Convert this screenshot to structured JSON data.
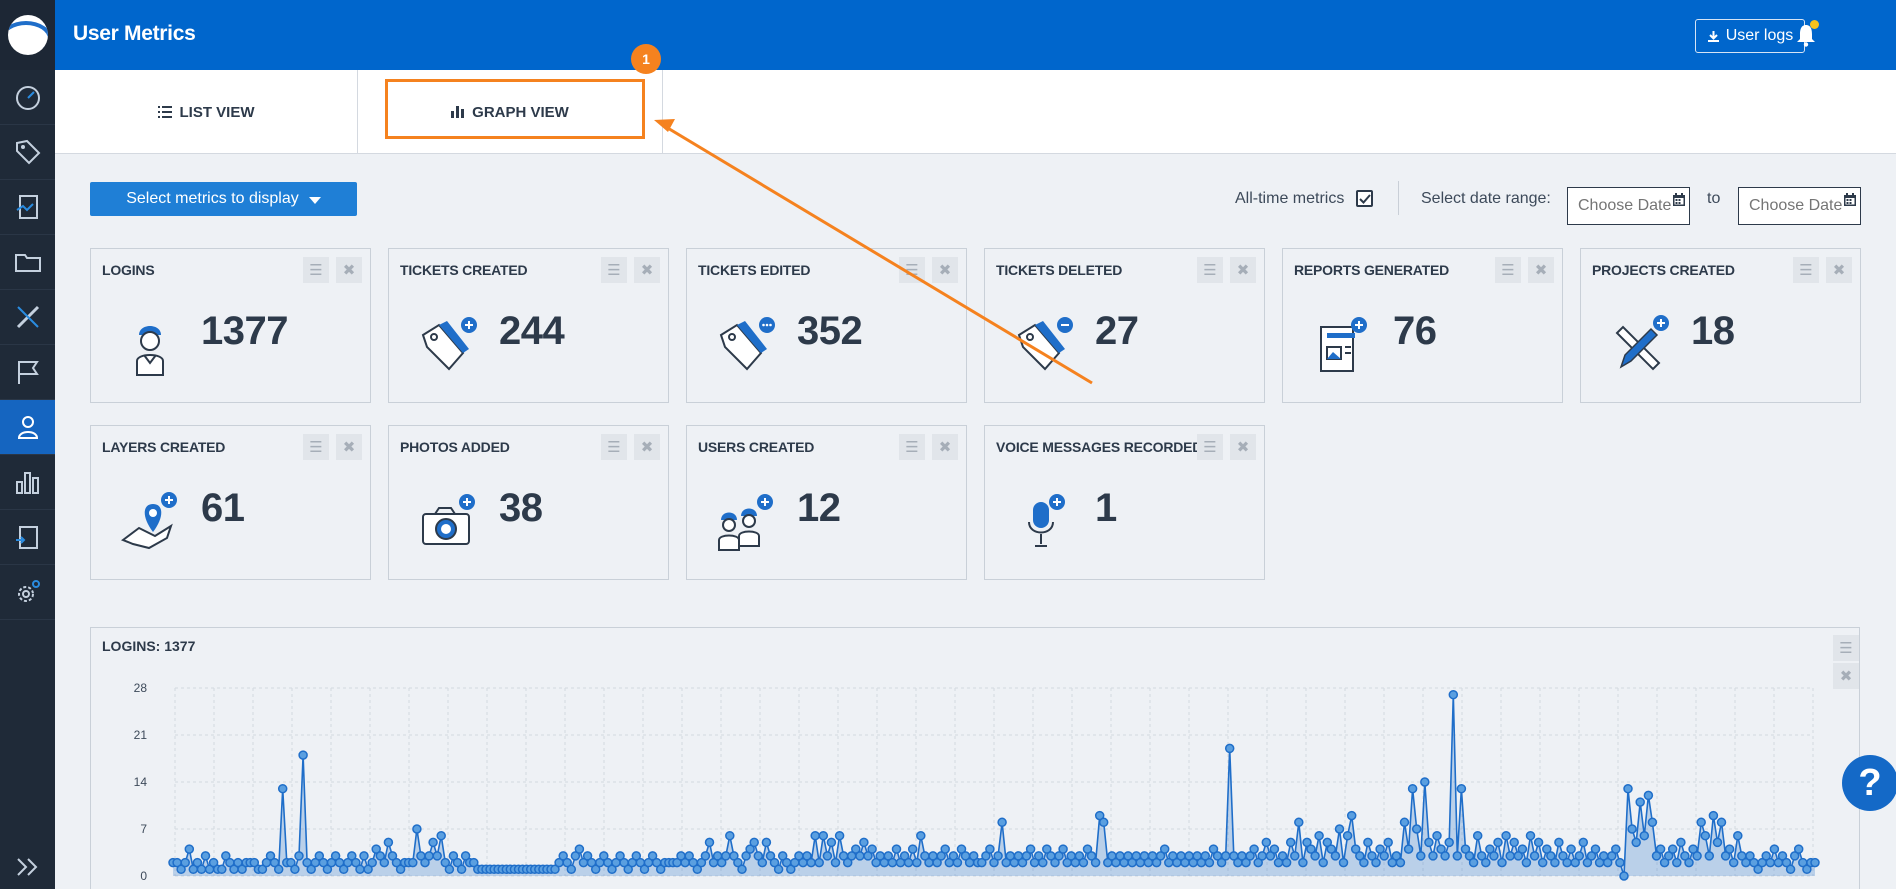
{
  "header": {
    "title": "User Metrics",
    "user_logs_label": "User logs"
  },
  "tabs": [
    {
      "label": "LIST VIEW",
      "icon": "list-icon"
    },
    {
      "label": "GRAPH VIEW",
      "icon": "bar-chart-icon"
    }
  ],
  "annotation": {
    "step": "1",
    "color": "#f5821f"
  },
  "toolbar": {
    "select_label": "Select metrics to display",
    "all_time_label": "All-time metrics",
    "all_time_checked": true,
    "date_range_label": "Select date range:",
    "date_from_placeholder": "Choose Date",
    "to_label": "to",
    "date_to_placeholder": "Choose Date"
  },
  "metrics": [
    {
      "title": "LOGINS",
      "value": "1377",
      "icon": "worker-helmet-icon"
    },
    {
      "title": "TICKETS CREATED",
      "value": "244",
      "icon": "tag-plus-icon"
    },
    {
      "title": "TICKETS EDITED",
      "value": "352",
      "icon": "tag-edit-icon"
    },
    {
      "title": "TICKETS DELETED",
      "value": "27",
      "icon": "tag-minus-icon"
    },
    {
      "title": "REPORTS GENERATED",
      "value": "76",
      "icon": "report-plus-icon"
    },
    {
      "title": "PROJECTS CREATED",
      "value": "18",
      "icon": "ruler-pencil-plus-icon"
    },
    {
      "title": "LAYERS CREATED",
      "value": "61",
      "icon": "map-pin-plus-icon"
    },
    {
      "title": "PHOTOS ADDED",
      "value": "38",
      "icon": "camera-plus-icon"
    },
    {
      "title": "USERS CREATED",
      "value": "12",
      "icon": "users-plus-icon"
    },
    {
      "title": "VOICE MESSAGES RECORDED",
      "value": "1",
      "icon": "microphone-plus-icon"
    }
  ],
  "chart": {
    "title": "LOGINS: 1377",
    "color": "#1f6ec9"
  },
  "chart_data": {
    "type": "line",
    "title": "LOGINS: 1377",
    "ylim": [
      0,
      28
    ],
    "yticks": [
      0,
      7,
      14,
      21,
      28
    ],
    "grid": true,
    "values": [
      2,
      2,
      1,
      2,
      4,
      1,
      2,
      1,
      3,
      1,
      2,
      1,
      1,
      3,
      2,
      1,
      2,
      1,
      2,
      2,
      2,
      1,
      1,
      2,
      3,
      2,
      1,
      13,
      2,
      2,
      1,
      3,
      18,
      2,
      1,
      2,
      3,
      2,
      1,
      2,
      3,
      2,
      1,
      2,
      3,
      2,
      1,
      3,
      1,
      2,
      4,
      3,
      2,
      5,
      3,
      2,
      1,
      2,
      2,
      2,
      7,
      3,
      2,
      3,
      5,
      3,
      6,
      2,
      1,
      3,
      2,
      1,
      3,
      2,
      2,
      1,
      1,
      1,
      1,
      1,
      1,
      1,
      1,
      1,
      1,
      1,
      1,
      1,
      1,
      1,
      1,
      1,
      1,
      1,
      1,
      2,
      3,
      2,
      1,
      3,
      4,
      2,
      3,
      2,
      1,
      2,
      3,
      2,
      1,
      2,
      3,
      2,
      1,
      2,
      3,
      2,
      1,
      2,
      3,
      2,
      1,
      2,
      2,
      2,
      2,
      3,
      2,
      3,
      2,
      1,
      2,
      3,
      5,
      2,
      3,
      2,
      3,
      6,
      3,
      2,
      1,
      3,
      4,
      5,
      3,
      2,
      5,
      3,
      2,
      1,
      3,
      2,
      1,
      2,
      3,
      2,
      3,
      2,
      6,
      2,
      6,
      3,
      5,
      2,
      6,
      3,
      2,
      3,
      4,
      3,
      5,
      3,
      4,
      2,
      3,
      2,
      3,
      2,
      4,
      2,
      3,
      2,
      4,
      2,
      6,
      3,
      2,
      3,
      2,
      3,
      4,
      2,
      3,
      2,
      4,
      3,
      2,
      3,
      2,
      2,
      3,
      4,
      2,
      3,
      8,
      2,
      3,
      2,
      3,
      2,
      3,
      4,
      2,
      3,
      2,
      4,
      3,
      2,
      3,
      4,
      2,
      3,
      2,
      3,
      2,
      4,
      3,
      2,
      9,
      8,
      2,
      3,
      2,
      3,
      2,
      3,
      2,
      3,
      2,
      3,
      2,
      3,
      2,
      3,
      4,
      2,
      3,
      2,
      3,
      2,
      3,
      2,
      3,
      2,
      3,
      2,
      4,
      3,
      2,
      3,
      19,
      3,
      2,
      3,
      2,
      3,
      4,
      2,
      3,
      5,
      3,
      4,
      2,
      3,
      2,
      5,
      3,
      8,
      2,
      5,
      4,
      3,
      6,
      2,
      5,
      4,
      3,
      7,
      2,
      6,
      9,
      4,
      3,
      2,
      5,
      3,
      2,
      4,
      3,
      5,
      2,
      3,
      2,
      8,
      4,
      13,
      7,
      3,
      14,
      5,
      3,
      6,
      4,
      3,
      5,
      27,
      3,
      13,
      4,
      3,
      2,
      6,
      3,
      2,
      4,
      3,
      5,
      2,
      6,
      3,
      5,
      3,
      4,
      2,
      6,
      3,
      5,
      2,
      4,
      3,
      2,
      5,
      3,
      2,
      4,
      2,
      3,
      5,
      2,
      3,
      4,
      2,
      3,
      2,
      3,
      4,
      2,
      0,
      13,
      7,
      5,
      11,
      6,
      12,
      8,
      3,
      4,
      2,
      3,
      4,
      2,
      5,
      3,
      2,
      4,
      3,
      8,
      6,
      3,
      9,
      5,
      8,
      3,
      4,
      2,
      6,
      3,
      2,
      3,
      2,
      1,
      2,
      3,
      2,
      4,
      2,
      3,
      2,
      1,
      3,
      4,
      2,
      1,
      2,
      2
    ]
  }
}
